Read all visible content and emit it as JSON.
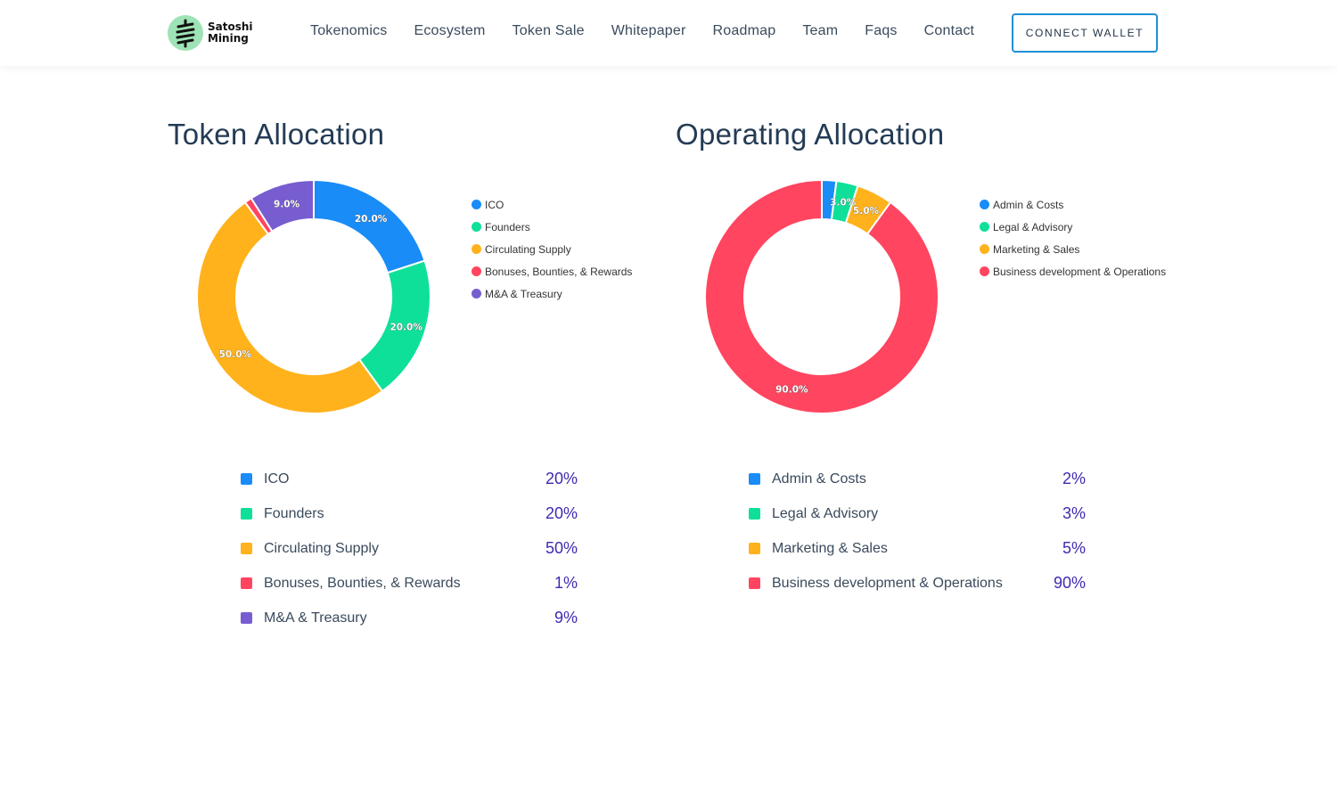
{
  "header": {
    "logo": {
      "line1": "Satoshi",
      "line2": "Mining",
      "icon": "satoshi-mining-logo"
    },
    "nav": [
      "Tokenomics",
      "Ecosystem",
      "Token Sale",
      "Whitepaper",
      "Roadmap",
      "Team",
      "Faqs",
      "Contact"
    ],
    "connect_label": "CONNECT WALLET"
  },
  "colors": {
    "blue": "#1a8cf7",
    "green": "#0ee09a",
    "orange": "#ffb21c",
    "red": "#ff4560",
    "purple": "#775dd0",
    "accent_text": "#3f2ab0",
    "button_border": "#1e90d6"
  },
  "token_allocation": {
    "title": "Token Allocation",
    "legend": [
      "ICO",
      "Founders",
      "Circulating Supply",
      "Bonuses, Bounties, & Rewards",
      "M&A & Treasury"
    ],
    "rows": [
      {
        "label": "ICO",
        "value": "20%"
      },
      {
        "label": "Founders",
        "value": "20%"
      },
      {
        "label": "Circulating Supply",
        "value": "50%"
      },
      {
        "label": "Bonuses, Bounties, & Rewards",
        "value": "1%"
      },
      {
        "label": "M&A & Treasury",
        "value": "9%"
      }
    ]
  },
  "operating_allocation": {
    "title": "Operating Allocation",
    "legend": [
      "Admin & Costs",
      "Legal & Advisory",
      "Marketing & Sales",
      "Business development & Operations"
    ],
    "rows": [
      {
        "label": "Admin & Costs",
        "value": "2%"
      },
      {
        "label": "Legal & Advisory",
        "value": "3%"
      },
      {
        "label": "Marketing & Sales",
        "value": "5%"
      },
      {
        "label": "Business development & Operations",
        "value": "90%"
      }
    ]
  },
  "chart_data": [
    {
      "type": "pie",
      "title": "Token Allocation",
      "categories": [
        "ICO",
        "Founders",
        "Circulating Supply",
        "Bonuses, Bounties, & Rewards",
        "M&A & Treasury"
      ],
      "values": [
        20,
        20,
        50,
        1,
        9
      ],
      "colors": [
        "#1a8cf7",
        "#0ee09a",
        "#ffb21c",
        "#ff4560",
        "#775dd0"
      ],
      "data_labels": [
        "20.0%",
        "20.0%",
        "50.0%",
        "",
        "9.0%"
      ],
      "legend": "right",
      "donut": true
    },
    {
      "type": "pie",
      "title": "Operating Allocation",
      "categories": [
        "Admin & Costs",
        "Legal & Advisory",
        "Marketing & Sales",
        "Business development & Operations"
      ],
      "values": [
        2,
        3,
        5,
        90
      ],
      "colors": [
        "#1a8cf7",
        "#0ee09a",
        "#ffb21c",
        "#ff4560"
      ],
      "data_labels": [
        "",
        "3.0%",
        "5.0%",
        "90.0%"
      ],
      "legend": "right",
      "donut": true
    }
  ]
}
